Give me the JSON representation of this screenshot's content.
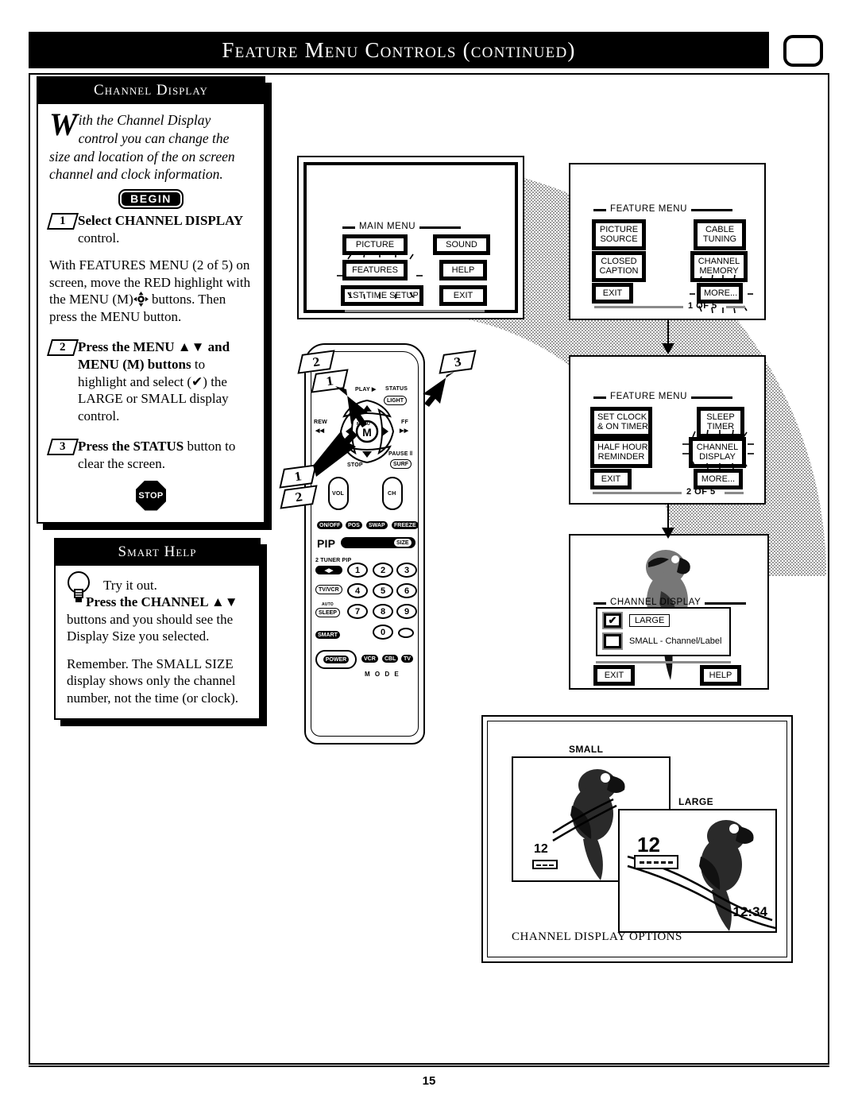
{
  "header": {
    "title": "Feature Menu Controls (continued)",
    "tv_icon": "tv-screen-icon"
  },
  "page": {
    "number": "15"
  },
  "channel_display_panel": {
    "heading": "Channel Display",
    "intro_dropcap": "W",
    "intro": "ith the Channel Display control you can change the size and location of the on screen channel and clock information.",
    "begin_badge": "BEGIN",
    "stop_badge": "STOP",
    "steps": [
      {
        "number": "1",
        "bold": "Select CHANNEL DISPLAY",
        "rest": " control.",
        "extra": "With FEATURES MENU (2 of 5) on screen, move the RED highlight with the MENU (M)",
        "extra2": " buttons. Then press the MENU button."
      },
      {
        "number": "2",
        "bold": "Press the MENU ▲▼ and MENU (M) buttons",
        "rest": " to highlight and select (✔) the LARGE or SMALL display control."
      },
      {
        "number": "3",
        "bold": "Press the STATUS",
        "rest": " button to clear the screen."
      }
    ]
  },
  "smart_help": {
    "heading": "Smart Help",
    "icon": "lightbulb-icon",
    "line1": "Try it out.",
    "line2_bold": "Press the CHANNEL ▲▼",
    "line2_rest": " buttons and you should see the Display Size you selected.",
    "line3": "Remember. The SMALL SIZE display shows only the channel number, not the time (or clock)."
  },
  "main_menu": {
    "title": "MAIN MENU",
    "buttons": [
      {
        "label": "PICTURE",
        "highlighted": false
      },
      {
        "label": "SOUND",
        "highlighted": false
      },
      {
        "label": "FEATURES",
        "highlighted": true
      },
      {
        "label": "HELP",
        "highlighted": false
      },
      {
        "label": "1ST TIME SETUP",
        "highlighted": false
      },
      {
        "label": "EXIT",
        "highlighted": false
      }
    ]
  },
  "feature_menu_1": {
    "title": "FEATURE MENU",
    "page_indicator": "1 OF 5",
    "buttons": [
      {
        "line1": "PICTURE",
        "line2": "SOURCE",
        "highlighted": false
      },
      {
        "line1": "CABLE",
        "line2": "TUNING",
        "highlighted": false
      },
      {
        "line1": "CLOSED",
        "line2": "CAPTION",
        "highlighted": false
      },
      {
        "line1": "CHANNEL",
        "line2": "MEMORY",
        "highlighted": false
      },
      {
        "line1": "EXIT",
        "line2": "",
        "highlighted": false
      },
      {
        "line1": "MORE...",
        "line2": "",
        "highlighted": true
      }
    ]
  },
  "feature_menu_2": {
    "title": "FEATURE MENU",
    "page_indicator": "2 OF 5",
    "buttons": [
      {
        "line1": "SET CLOCK",
        "line2": "& ON TIMER",
        "highlighted": false
      },
      {
        "line1": "SLEEP",
        "line2": "TIMER",
        "highlighted": false
      },
      {
        "line1": "HALF HOUR",
        "line2": "REMINDER",
        "highlighted": false
      },
      {
        "line1": "CHANNEL",
        "line2": "DISPLAY",
        "highlighted": true
      },
      {
        "line1": "EXIT",
        "line2": "",
        "highlighted": false
      },
      {
        "line1": "MORE...",
        "line2": "",
        "highlighted": false
      }
    ]
  },
  "channel_display_screen": {
    "title": "CHANNEL DISPLAY",
    "options": [
      {
        "label": "LARGE",
        "checked": true
      },
      {
        "label": "SMALL - Channel/Label",
        "checked": false
      }
    ],
    "exit_label": "EXIT",
    "help_label": "HELP"
  },
  "options_panel": {
    "caption": "CHANNEL DISPLAY OPTIONS",
    "small": {
      "label": "SMALL",
      "channel": "12"
    },
    "large": {
      "label": "LARGE",
      "channel": "12",
      "clock": "12:34"
    }
  },
  "remote": {
    "transport": {
      "play": "PLAY ▶",
      "rew": "REW",
      "rew_sym": "◀◀",
      "ff": "FF",
      "ff_sym": "▶▶",
      "stop": "STOP",
      "pause": "PAUSE ‖",
      "menu_center": "M",
      "menu_label": "MENU"
    },
    "status_key": "STATUS",
    "light_key": "LIGHT",
    "surf_key": "SURF",
    "vol_label": "VOL",
    "ch_label": "CH",
    "pip_row": [
      "ON/OFF",
      "POS",
      "SWAP",
      "FREEZE"
    ],
    "pip_label": "PIP",
    "size_key": "SIZE",
    "tuner_label": "2 TUNER PIP",
    "side_keys": [
      "TV/VCR",
      "SLEEP",
      "SMART"
    ],
    "sleep_sub": "AUTO",
    "power_key": "POWER",
    "mode_keys": [
      "VCR",
      "CBL",
      "TV"
    ],
    "mode_label": "M O D E",
    "numbers": [
      "1",
      "2",
      "3",
      "4",
      "5",
      "6",
      "7",
      "8",
      "9",
      "0"
    ]
  },
  "callouts": [
    "1",
    "2",
    "3",
    "1",
    "2"
  ]
}
